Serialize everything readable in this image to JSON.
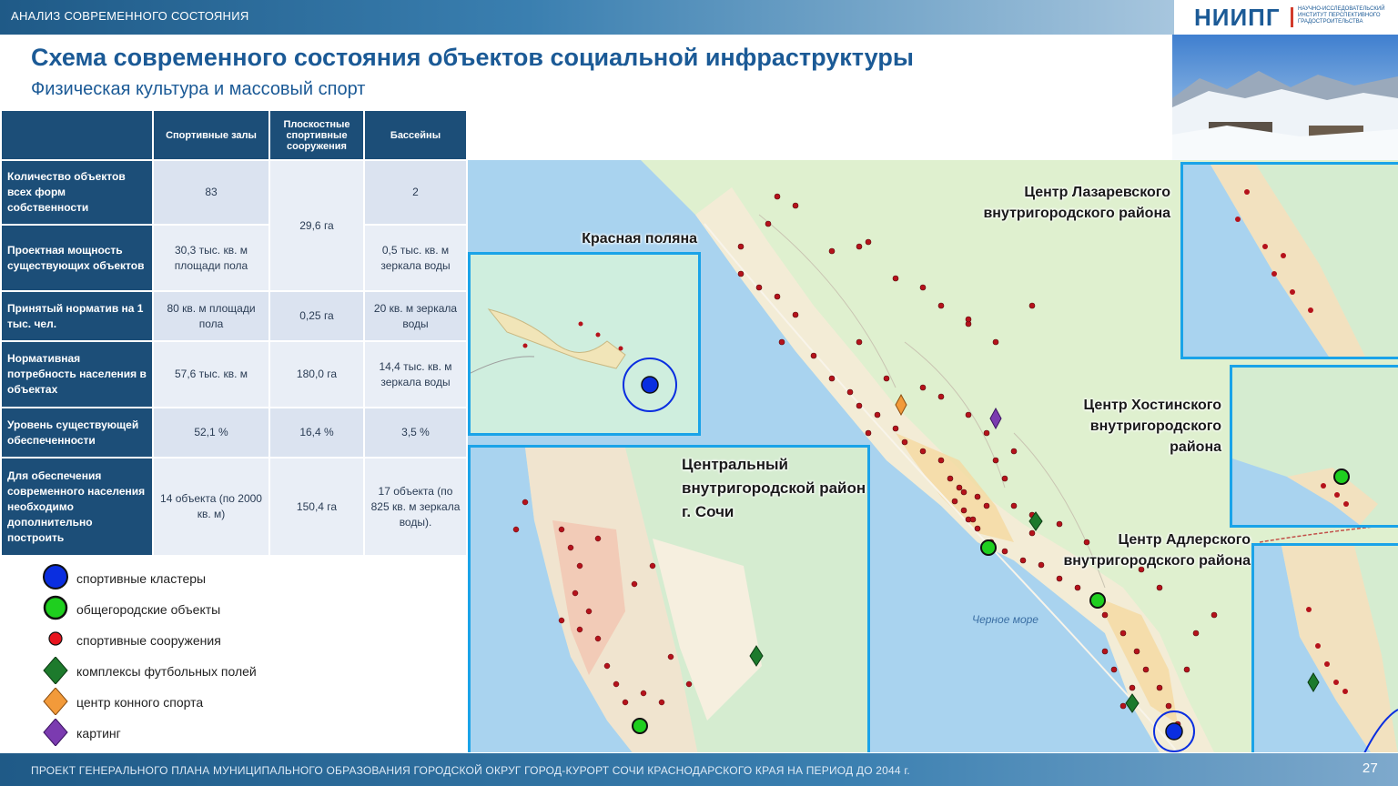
{
  "header": {
    "section": "АНАЛИЗ СОВРЕМЕННОГО СОСТОЯНИЯ",
    "logo_text": "НИИПГ",
    "logo_sub": "НАУЧНО-ИССЛЕДОВАТЕЛЬСКИЙ ИНСТИТУТ ПЕРСПЕКТИВНОГО ГРАДОСТРОИТЕЛЬСТВА"
  },
  "title": "Схема современного состояния объектов социальной инфраструктуры",
  "subtitle": "Физическая культура и массовый спорт",
  "table": {
    "columns": [
      "Спортивные залы",
      "Плоскостные спортивные сооружения",
      "Бассейны"
    ],
    "rows": [
      {
        "label": "Количество объектов всех форм собственности",
        "c1": "83",
        "c2": "29,6 га",
        "c3": "2"
      },
      {
        "label": "Проектная мощность существующих объектов",
        "c1": "30,3 тыс. кв. м площади пола",
        "c3": "0,5 тыс. кв. м зеркала воды"
      },
      {
        "label": "Принятый норматив на 1 тыс. чел.",
        "c1": "80 кв. м площади пола",
        "c2": "0,25 га",
        "c3": "20 кв. м зеркала воды"
      },
      {
        "label": "Нормативная потребность населения в объектах",
        "c1": "57,6 тыс. кв. м",
        "c2": "180,0 га",
        "c3": "14,4 тыс. кв. м зеркала воды"
      },
      {
        "label": "Уровень существующей обеспеченности",
        "c1": "52,1 %",
        "c2": "16,4 %",
        "c3": "3,5 %"
      },
      {
        "label": "Для обеспечения современного населения необходимо дополнительно построить",
        "c1": "14 объекта (по 2000 кв. м)",
        "c2": "150,4 га",
        "c3": "17 объекта (по 825 кв. м зеркала воды)."
      }
    ]
  },
  "legend": [
    {
      "label": "спортивные кластеры",
      "icon": "blue-circle-icon",
      "color": "#0a2ee0"
    },
    {
      "label": "общегородские объекты",
      "icon": "green-circle-icon",
      "color": "#1fcf1f"
    },
    {
      "label": "спортивные сооружения",
      "icon": "red-dot-icon",
      "color": "#e8141e"
    },
    {
      "label": "комплексы футбольных полей",
      "icon": "green-diamond-icon",
      "color": "#1d7a2c"
    },
    {
      "label": "центр конного спорта",
      "icon": "orange-diamond-icon",
      "color": "#f29a3a"
    },
    {
      "label": "картинг",
      "icon": "purple-diamond-icon",
      "color": "#7b3bb0"
    }
  ],
  "map": {
    "labels": {
      "krasnaya": "Красная поляна",
      "central": "Центральный внутригородской район г. Сочи",
      "lazarevsky": "Центр Лазаревского внутригородского района",
      "khostinsky": "Центр Хостинского внутригородского района",
      "adlersky": "Центр Адлерского внутригородского района",
      "sea": "Черное море"
    }
  },
  "footer": {
    "text": "ПРОЕКТ ГЕНЕРАЛЬНОГО ПЛАНА МУНИЦИПАЛЬНОГО ОБРАЗОВАНИЯ ГОРОДСКОЙ ОКРУГ ГОРОД-КУРОРТ СОЧИ КРАСНОДАРСКОГО КРАЯ НА ПЕРИОД ДО 2044 г.",
    "page": "27"
  }
}
